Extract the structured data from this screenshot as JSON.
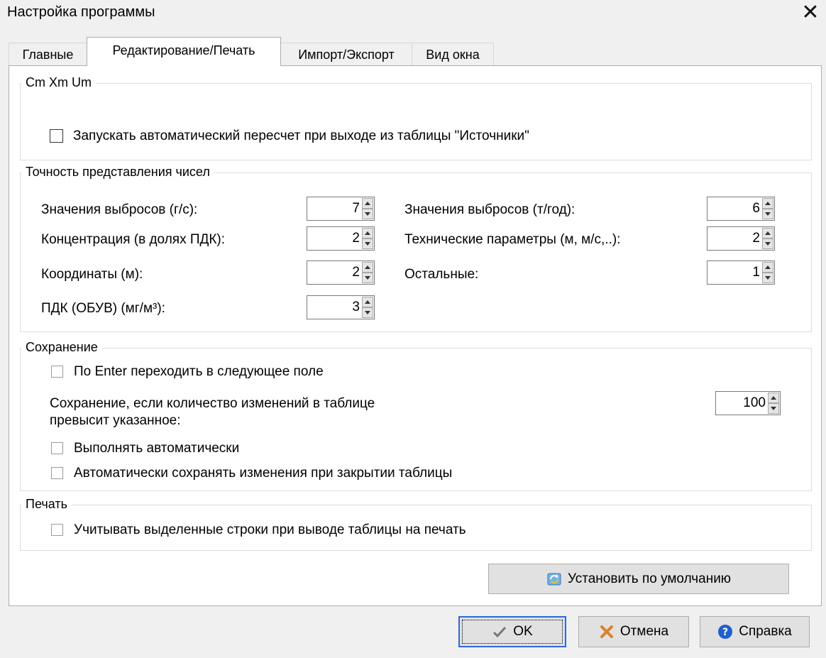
{
  "window": {
    "title": "Настройка программы",
    "close_glyph": "✕"
  },
  "tabs": [
    {
      "label": "Главные"
    },
    {
      "label": "Редактирование/Печать"
    },
    {
      "label": "Импорт/Экспорт"
    },
    {
      "label": "Вид окна"
    }
  ],
  "group_cm": {
    "legend": "Cm Xm Um",
    "auto_recalc_label": "Запускать автоматический пересчет при выходе из таблицы \"Источники\"",
    "auto_recalc_checked": false
  },
  "group_precision": {
    "legend": "Точность представления чисел",
    "emissions_gs_label": "Значения выбросов (г/с):",
    "emissions_gs_value": "7",
    "concentration_label": "Концентрация (в долях ПДК):",
    "concentration_value": "2",
    "coords_label": "Координаты (м):",
    "coords_value": "2",
    "pdk_label": "ПДК (ОБУВ) (мг/м³):",
    "pdk_value": "3",
    "emissions_ty_label": "Значения выбросов (т/год):",
    "emissions_ty_value": "6",
    "tech_params_label": "Технические параметры (м, м/с,..):",
    "tech_params_value": "2",
    "other_label": "Остальные:",
    "other_value": "1"
  },
  "group_save": {
    "legend": "Сохранение",
    "enter_next_label": "По Enter переходить в следующее поле",
    "threshold_label_line1": "Сохранение, если количество изменений в таблице",
    "threshold_label_line2": "превысит указанное:",
    "threshold_value": "100",
    "auto_exec_label": "Выполнять автоматически",
    "auto_save_close_label": "Автоматически сохранять изменения при закрытии таблицы"
  },
  "group_print": {
    "legend": "Печать",
    "selected_rows_label": "Учитывать выделенные строки при выводе таблицы на печать"
  },
  "buttons": {
    "defaults_label": "Установить по умолчанию",
    "ok_label": "OK",
    "cancel_label": "Отмена",
    "help_label": "Справка"
  },
  "colors": {
    "accent": "#2f6bd2",
    "cancel_icon": "#d9822b",
    "help_icon": "#1f5fd0"
  }
}
